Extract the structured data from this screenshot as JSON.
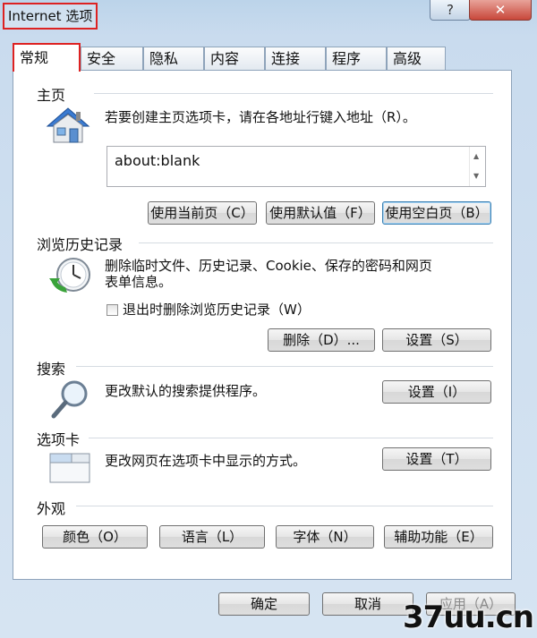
{
  "window": {
    "title": "Internet 选项"
  },
  "titlebar": {
    "help_label": "?",
    "close_label": "✕"
  },
  "tabs": [
    {
      "label": "常规"
    },
    {
      "label": "安全"
    },
    {
      "label": "隐私"
    },
    {
      "label": "内容"
    },
    {
      "label": "连接"
    },
    {
      "label": "程序"
    },
    {
      "label": "高级"
    }
  ],
  "homepage": {
    "title": "主页",
    "description": "若要创建主页选项卡，请在各地址行键入地址（R）。",
    "value": "about:blank",
    "use_current": "使用当前页（C）",
    "use_default": "使用默认值（F）",
    "use_blank": "使用空白页（B）"
  },
  "history": {
    "title": "浏览历史记录",
    "description_line1": "删除临时文件、历史记录、Cookie、保存的密码和网页",
    "description_line2": "表单信息。",
    "checkbox_label": "退出时删除浏览历史记录（W）",
    "checkbox_checked": false,
    "delete_button": "删除（D）...",
    "settings_button": "设置（S）"
  },
  "search": {
    "title": "搜索",
    "description": "更改默认的搜索提供程序。",
    "settings_button": "设置（I）"
  },
  "tabs_section": {
    "title": "选项卡",
    "description": "更改网页在选项卡中显示的方式。",
    "settings_button": "设置（T）"
  },
  "appearance": {
    "title": "外观",
    "colors_button": "颜色（O）",
    "languages_button": "语言（L）",
    "fonts_button": "字体（N）",
    "accessibility_button": "辅助功能（E）"
  },
  "footer": {
    "ok_button": "确定",
    "cancel_button": "取消",
    "apply_button": "应用（A）"
  },
  "watermark": {
    "text": "37uu.cn"
  }
}
